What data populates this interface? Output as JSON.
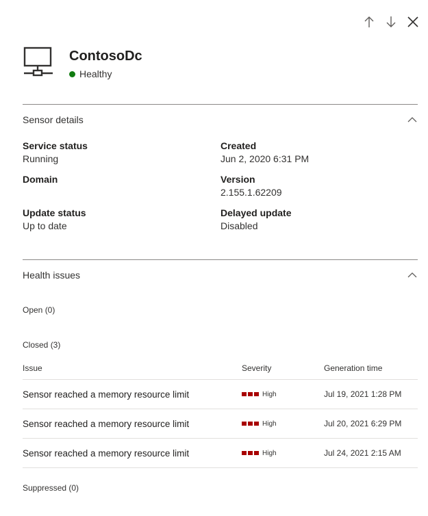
{
  "header": {
    "title": "ContosoDc",
    "health_status": "Healthy",
    "health_color": "#107c10",
    "icon": "computer-network-icon"
  },
  "nav": {
    "up_icon": "arrow-up-icon",
    "down_icon": "arrow-down-icon",
    "close_icon": "close-icon"
  },
  "sensor_details": {
    "section_title": "Sensor details",
    "fields": {
      "service_status": {
        "label": "Service status",
        "value": "Running"
      },
      "created": {
        "label": "Created",
        "value": "Jun 2, 2020 6:31 PM"
      },
      "domain": {
        "label": "Domain",
        "value": ""
      },
      "version": {
        "label": "Version",
        "value": "2.155.1.62209"
      },
      "update_status": {
        "label": "Update status",
        "value": "Up to date"
      },
      "delayed_update": {
        "label": "Delayed update",
        "value": "Disabled"
      }
    }
  },
  "health_issues": {
    "section_title": "Health issues",
    "open_label": "Open (0)",
    "closed_label": "Closed (3)",
    "suppressed_label": "Suppressed (0)",
    "table": {
      "headers": {
        "issue": "Issue",
        "severity": "Severity",
        "generation_time": "Generation time"
      },
      "rows": [
        {
          "issue": "Sensor reached a memory resource limit",
          "severity": "High",
          "time": "Jul 19, 2021 1:28 PM"
        },
        {
          "issue": "Sensor reached a memory resource limit",
          "severity": "High",
          "time": "Jul 20, 2021 6:29 PM"
        },
        {
          "issue": "Sensor reached a memory resource limit",
          "severity": "High",
          "time": "Jul 24, 2021 2:15 AM"
        }
      ],
      "severity_color": "#a80000"
    }
  }
}
